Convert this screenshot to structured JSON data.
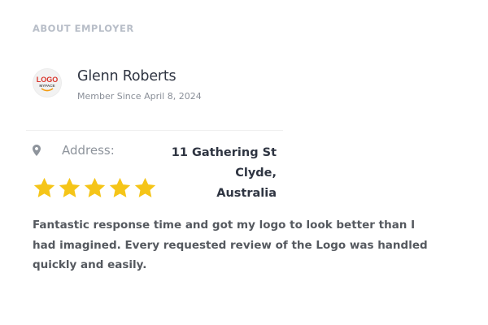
{
  "section": {
    "title": "ABOUT EMPLOYER"
  },
  "employer": {
    "logo_text_top": "LOGO",
    "logo_text_bottom": "MYFACE",
    "name": "Glenn Roberts",
    "member_since": "Member Since April 8, 2024"
  },
  "address": {
    "label": "Address:",
    "line1": "11 Gathering St Clyde,",
    "line2": "Australia",
    "icon": "map-pin-icon"
  },
  "rating": {
    "value": 5,
    "max": 5,
    "color": "#f5c518"
  },
  "review": {
    "text": "Fantastic response time and got my logo to look better than I had imagined. Every requested review of the Logo was handled quickly and easily."
  },
  "colors": {
    "title": "#b8bec8",
    "name": "#2f3542",
    "muted": "#8a8f98",
    "star": "#f5c518",
    "logo_red": "#d9342b",
    "logo_orange": "#f39c12"
  }
}
